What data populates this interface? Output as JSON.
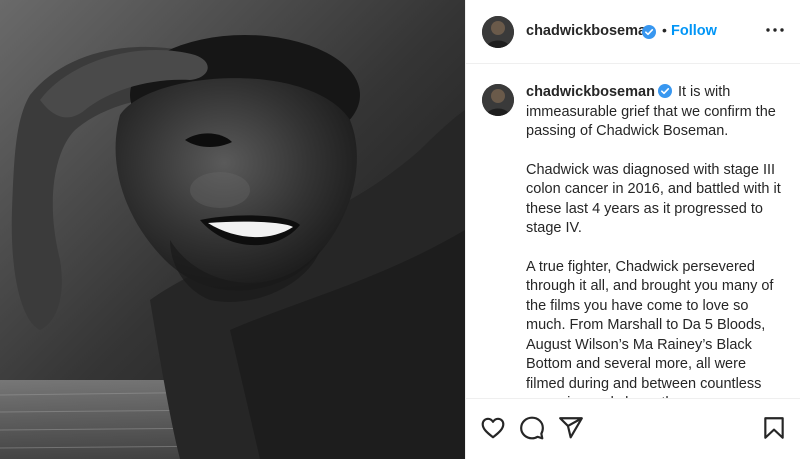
{
  "header": {
    "username": "chadwickboseman",
    "follow_label": "Follow",
    "separator": "•"
  },
  "caption": {
    "username": "chadwickboseman",
    "first_line": "It is with immeasurable grief that we confirm the passing of Chadwick Boseman.",
    "paragraphs": [
      "Chadwick was diagnosed with stage III colon cancer in 2016, and battled with it these last 4 years as it progressed to stage IV.",
      "A true fighter, Chadwick persevered through it all, and brought you many of the films you have come to love so much. From Marshall to Da 5 Bloods, August Wilson’s Ma Rainey’s Black Bottom and several more, all were filmed during and between countless surgeries and chemotherapy."
    ]
  },
  "icons": {
    "verified": "verified-badge-icon",
    "more": "more-options-icon",
    "like": "heart-icon",
    "comment": "comment-icon",
    "share": "paper-plane-icon",
    "save": "bookmark-icon"
  },
  "colors": {
    "follow": "#0095f6",
    "verified": "#3897f0",
    "text": "#262626",
    "divider": "#efefef"
  }
}
